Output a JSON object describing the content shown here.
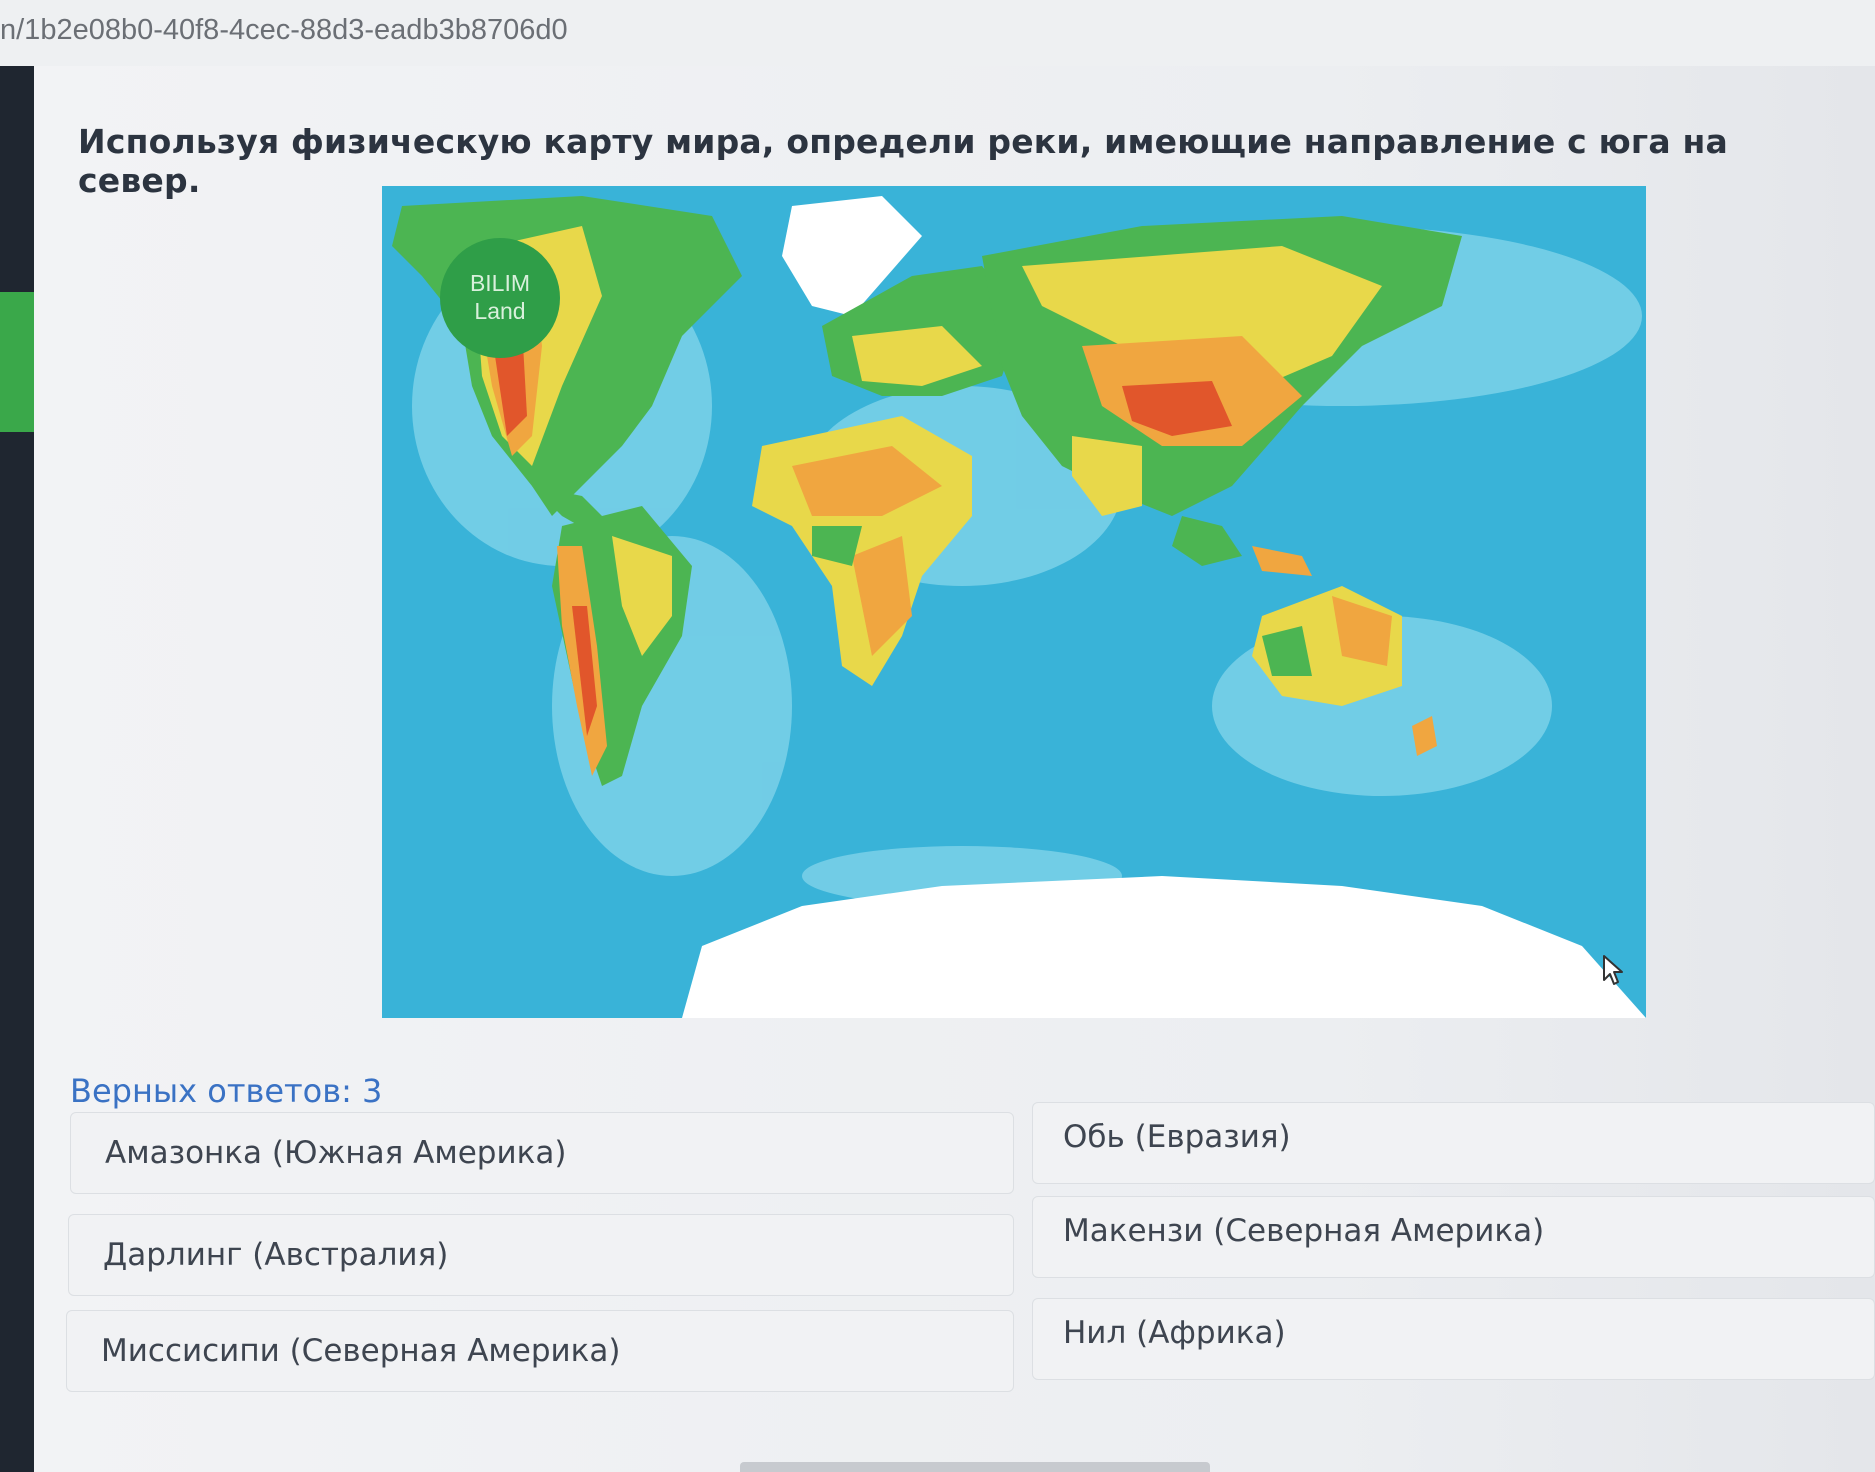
{
  "browser": {
    "url": "n/1b2e08b0-40f8-4cec-88d3-eadb3b8706d0"
  },
  "question": {
    "text": "Используя физическую карту мира, определи реки, имеющие направление с юга на север."
  },
  "map": {
    "logo_line1": "BILIM",
    "logo_line2": "Land",
    "colors": {
      "ocean": "#39b3d8",
      "shallow": "#7fd3ea",
      "lowland": "#4cb552",
      "plain": "#e8d84a",
      "upland": "#f0a640",
      "mountain": "#e1562b",
      "ice": "#ffffff"
    }
  },
  "answers": {
    "count_label": "Верных ответов: 3",
    "options": [
      "Амазонка (Южная Америка)",
      "Обь (Евразия)",
      "Дарлинг (Австралия)",
      "Макензи (Северная Америка)",
      "Миссисипи (Северная Америка)",
      "Нил (Африка)"
    ]
  },
  "icons": {
    "cursor": "mouse-pointer-icon"
  }
}
